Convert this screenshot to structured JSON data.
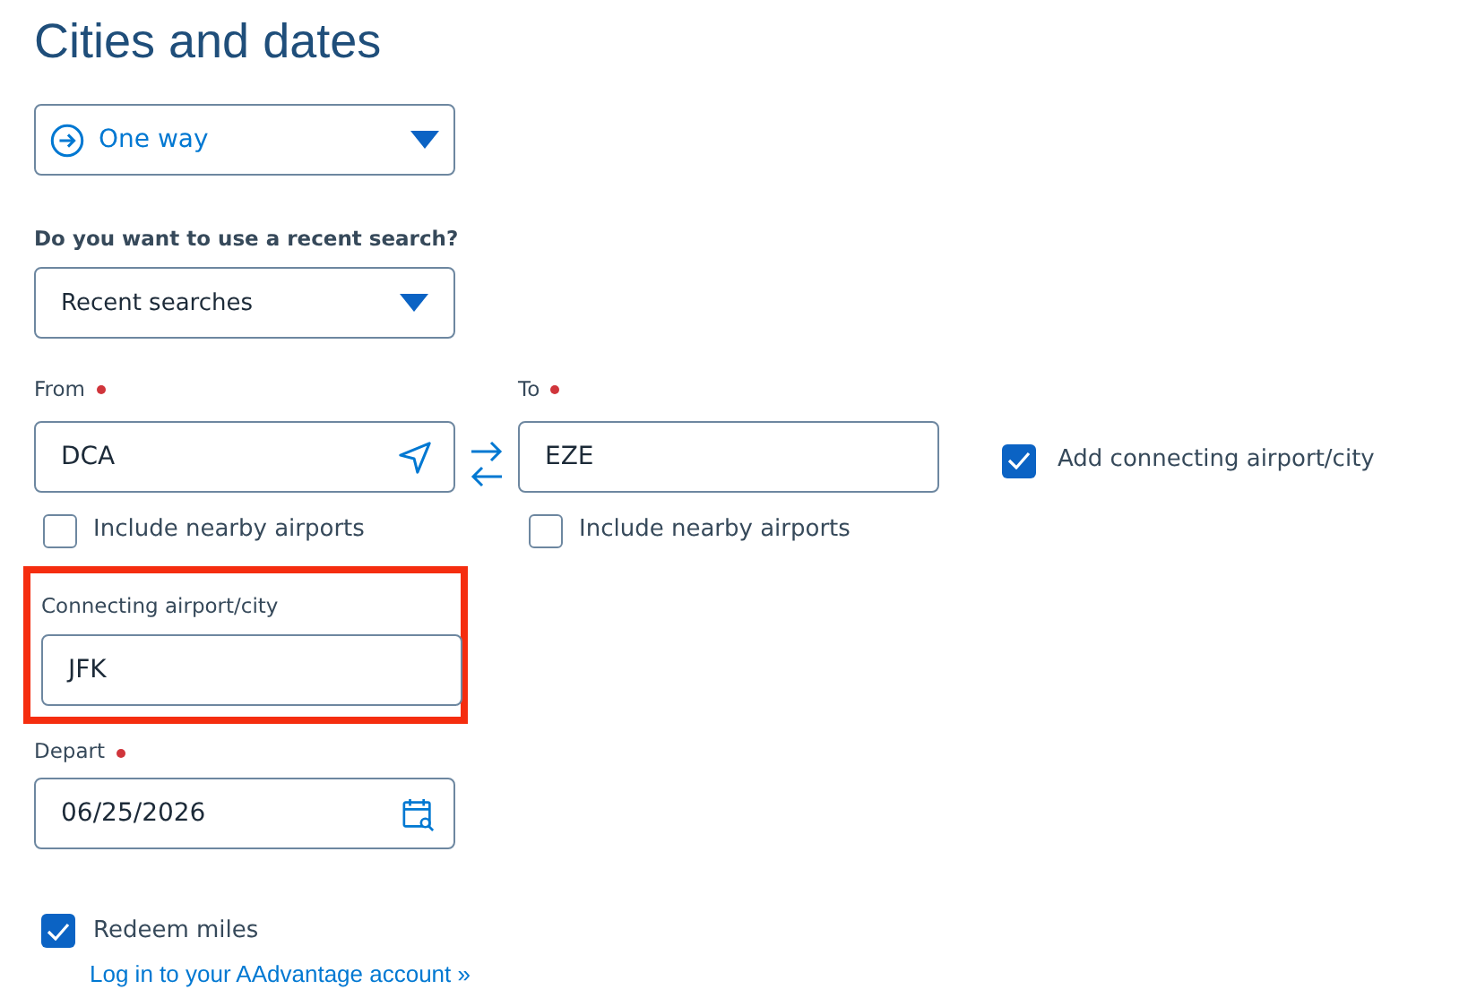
{
  "heading": "Cities and dates",
  "trip_type": {
    "value": "One way"
  },
  "recent_search": {
    "label": "Do you want to use a recent search?",
    "value": "Recent searches"
  },
  "from": {
    "label": "From",
    "required": true,
    "value": "DCA"
  },
  "to": {
    "label": "To",
    "required": true,
    "value": "EZE"
  },
  "nearby_checkboxes": [
    {
      "label": "Include nearby airports",
      "checked": false
    },
    {
      "label": "Include nearby airports",
      "checked": false
    }
  ],
  "add_connecting": {
    "label": "Add connecting airport/city",
    "checked": true
  },
  "connecting": {
    "label": "Connecting airport/city",
    "value": "JFK",
    "highlighted": true
  },
  "depart": {
    "label": "Depart",
    "required": true,
    "value": "06/25/2026"
  },
  "redeem_miles": {
    "label": "Redeem miles",
    "checked": true
  },
  "login_link": "Log in to your AAdvantage account »"
}
